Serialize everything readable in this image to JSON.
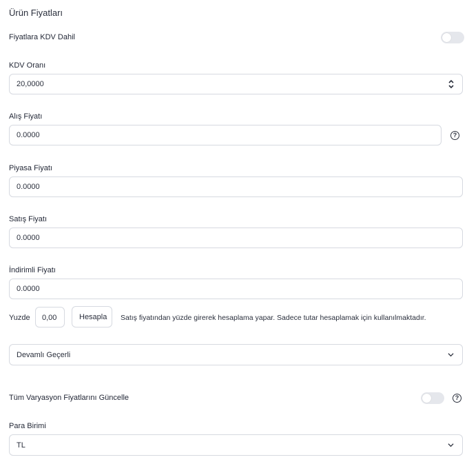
{
  "section_title": "Ürün Fiyatları",
  "kdv_included": {
    "label": "Fiyatlara KDV Dahil",
    "enabled": false
  },
  "kdv_rate": {
    "label": "KDV Oranı",
    "value": "20,0000"
  },
  "purchase_price": {
    "label": "Alış Fiyatı",
    "value": "0.0000"
  },
  "market_price": {
    "label": "Piyasa Fiyatı",
    "value": "0.0000"
  },
  "sale_price": {
    "label": "Satış Fiyatı",
    "value": "0.0000"
  },
  "discount_price": {
    "label": "İndirimli Fiyatı",
    "value": "0.0000"
  },
  "percent": {
    "label": "Yuzde",
    "value": "0,00",
    "button": "Hesapla",
    "note": "Satış fiyatından yüzde girerek hesaplama yapar. Sadece tutar hesaplamak için kullanılmaktadır."
  },
  "validity": {
    "selected": "Devamlı Geçerli"
  },
  "update_variations": {
    "label": "Tüm Varyasyon Fiyatlarını Güncelle",
    "enabled": false
  },
  "currency": {
    "label": "Para Birimi",
    "selected": "TL"
  },
  "icons": {
    "help": "?"
  }
}
